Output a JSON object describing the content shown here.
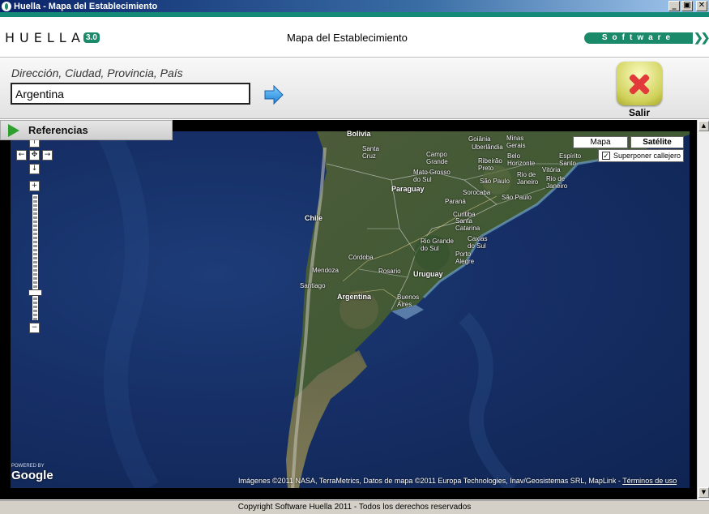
{
  "window": {
    "title": "Huella - Mapa del Establecimiento",
    "buttons": {
      "minimize": "_",
      "maximize": "▣",
      "close": "✕"
    }
  },
  "header": {
    "logo_text": "HUELLA",
    "logo_version": "3.0",
    "page_title": "Mapa del Establecimiento",
    "software_badge": "Software",
    "badge_chevrons": "❯❯"
  },
  "search": {
    "label": "Dirección, Ciudad, Provincia, País",
    "value": "Argentina"
  },
  "exit": {
    "label": "Salir"
  },
  "references": {
    "label": "Referencias"
  },
  "map": {
    "pan": {
      "up": "↑",
      "left": "←",
      "center": "✥",
      "right": "→",
      "down": "↓"
    },
    "zoom": {
      "in": "+",
      "out": "−",
      "level_fraction": 0.78
    },
    "map_types": {
      "mapa": "Mapa",
      "satelite": "Satélite",
      "active": "Satélite"
    },
    "overlay": {
      "label": "Superponer callejero",
      "checked": true,
      "check_mark": "✓"
    },
    "labels": {
      "bolivia": "Bolivia",
      "santa_cruz": "Santa\nCruz",
      "goiania": "Goiânia",
      "uberlandia": "Uberlândia",
      "minas_gerais": "Minas\nGerais",
      "belo_horizonte": "Belo\nHorizonte",
      "campo_grande": "Campo\nGrande",
      "ribeirao_preto": "Ribeirão\nPreto",
      "espirito_santo": "Espírito\nSanto",
      "mato_grosso": "Mato Grosso\ndo Sul",
      "vitoria": "Vitória",
      "paraguay": "Paraguay",
      "sao_paulo": "São Paulo",
      "rio_de_janeiro_state": "Rio de\nJaneiro",
      "rio_de_janeiro_city": "Rio de\nJaneiro",
      "sorocaba": "Sorocaba",
      "parana": "Paraná",
      "sao_paulo_city": "São Paulo",
      "chile": "Chile",
      "curitiba": "Curitiba",
      "santa_catarina": "Santa\nCatarina",
      "rio_grande": "Rio Grande\ndo Sul",
      "caxias": "Caxias\ndo Sul",
      "porto_alegre": "Porto\nAlegre",
      "cordoba": "Córdoba",
      "rosario": "Rosario",
      "uruguay": "Uruguay",
      "mendoza": "Mendoza",
      "santiago": "Santiago",
      "argentina": "Argentina",
      "buenos_aires": "Buenos\nAires"
    },
    "google_powered": "POWERED BY",
    "google_logo": "Google",
    "attribution": "Imágenes ©2011 NASA, TerraMetrics, Datos de mapa ©2011 Europa Technologies, Inav/Geosistemas SRL, MapLink - ",
    "terms": "Términos de uso"
  },
  "scrollbar": {
    "up": "▲",
    "down": "▼"
  },
  "status": {
    "copyright": "Copyright Software Huella 2011 - Todos los derechos reservados"
  }
}
